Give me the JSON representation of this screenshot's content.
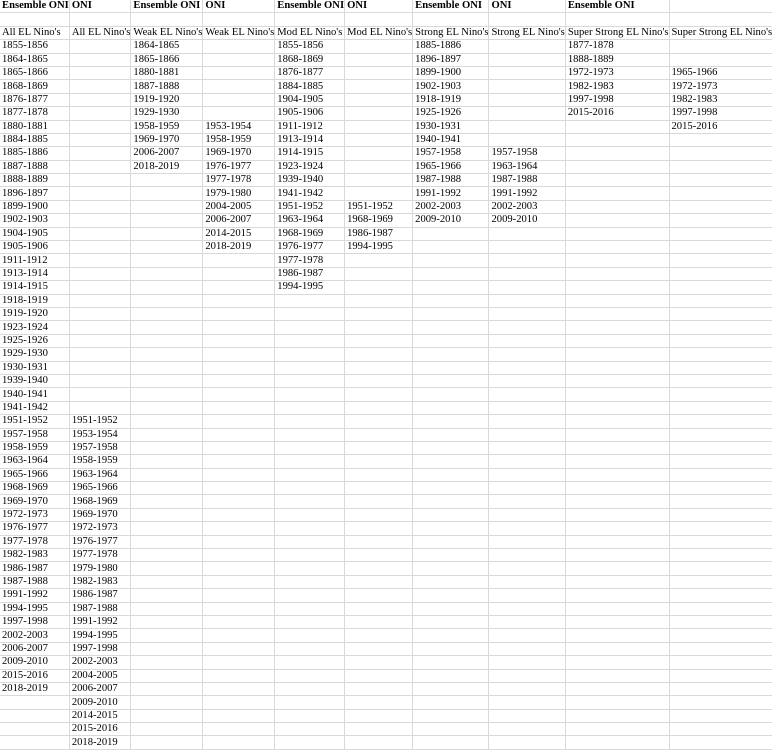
{
  "headers": [
    "Ensemble ONI",
    "ONI",
    "Ensemble ONI",
    "ONI",
    "Ensemble ONI",
    "ONI",
    "Ensemble ONI",
    "ONI",
    "Ensemble ONI",
    ""
  ],
  "subheaders": [
    "All EL Nino's",
    "All EL Nino's",
    "Weak EL Nino's",
    "Weak EL Nino's",
    "Mod EL Nino's",
    "Mod EL Nino's",
    "Strong EL Nino's",
    "Strong EL Nino's",
    "Super Strong EL Nino's",
    "Super Strong EL Nino's"
  ],
  "columns": [
    {
      "start": 0,
      "values": [
        "1855-1856",
        "1864-1865",
        "1865-1866",
        "1868-1869",
        "1876-1877",
        "1877-1878",
        "1880-1881",
        "1884-1885",
        "1885-1886",
        "1887-1888",
        "1888-1889",
        "1896-1897",
        "1899-1900",
        "1902-1903",
        "1904-1905",
        "1905-1906",
        "1911-1912",
        "1913-1914",
        "1914-1915",
        "1918-1919",
        "1919-1920",
        "1923-1924",
        "1925-1926",
        "1929-1930",
        "1930-1931",
        "1939-1940",
        "1940-1941",
        "1941-1942",
        "1951-1952",
        "1957-1958",
        "1958-1959",
        "1963-1964",
        "1965-1966",
        "1968-1969",
        "1969-1970",
        "1972-1973",
        "1976-1977",
        "1977-1978",
        "1982-1983",
        "1986-1987",
        "1987-1988",
        "1991-1992",
        "1994-1995",
        "1997-1998",
        "2002-2003",
        "2006-2007",
        "2009-2010",
        "2015-2016",
        "2018-2019"
      ]
    },
    {
      "start": 28,
      "values": [
        "1951-1952",
        "1953-1954",
        "1957-1958",
        "1958-1959",
        "1963-1964",
        "1965-1966",
        "1968-1969",
        "1969-1970",
        "1972-1973",
        "1976-1977",
        "1977-1978",
        "1979-1980",
        "1982-1983",
        "1986-1987",
        "1987-1988",
        "1991-1992",
        "1994-1995",
        "1997-1998",
        "2002-2003",
        "2004-2005",
        "2006-2007",
        "2009-2010",
        "2014-2015",
        "2015-2016",
        "2018-2019"
      ]
    },
    {
      "start": 0,
      "values": [
        "1864-1865",
        "1865-1866",
        "1880-1881",
        "1887-1888",
        "1919-1920",
        "1929-1930",
        "1958-1959",
        "1969-1970",
        "2006-2007",
        "2018-2019"
      ]
    },
    {
      "start": 6,
      "values": [
        "1953-1954",
        "1958-1959",
        "1969-1970",
        "1976-1977",
        "1977-1978",
        "1979-1980",
        "2004-2005",
        "2006-2007",
        "2014-2015",
        "2018-2019"
      ]
    },
    {
      "start": 0,
      "values": [
        "1855-1856",
        "1868-1869",
        "1876-1877",
        "1884-1885",
        "1904-1905",
        "1905-1906",
        "1911-1912",
        "1913-1914",
        "1914-1915",
        "1923-1924",
        "1939-1940",
        "1941-1942",
        "1951-1952",
        "1963-1964",
        "1968-1969",
        "1976-1977",
        "1977-1978",
        "1986-1987",
        "1994-1995"
      ]
    },
    {
      "start": 12,
      "values": [
        "1951-1952",
        "1968-1969",
        "1986-1987",
        "1994-1995"
      ]
    },
    {
      "start": 0,
      "values": [
        "1885-1886",
        "1896-1897",
        "1899-1900",
        "1902-1903",
        "1918-1919",
        "1925-1926",
        "1930-1931",
        "1940-1941",
        "1957-1958",
        "1965-1966",
        "1987-1988",
        "1991-1992",
        "2002-2003",
        "2009-2010"
      ]
    },
    {
      "start": 8,
      "values": [
        "1957-1958",
        "1963-1964",
        "1987-1988",
        "1991-1992",
        "2002-2003",
        "2009-2010"
      ]
    },
    {
      "start": 0,
      "values": [
        "1877-1878",
        "1888-1889",
        "1972-1973",
        "1982-1983",
        "1997-1998",
        "2015-2016"
      ]
    },
    {
      "start": 2,
      "values": [
        "1965-1966",
        "1972-1973",
        "1982-1983",
        "1997-1998",
        "2015-2016"
      ]
    }
  ]
}
